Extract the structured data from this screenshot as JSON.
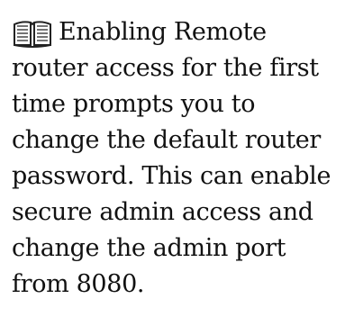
{
  "note": {
    "icon": "book-icon",
    "lines": [
      "Enabling Remote",
      "router access for the first",
      "time prompts you to",
      "change the default router",
      "password. This can enable",
      "secure admin access and",
      "change the admin port",
      "from 8080."
    ]
  }
}
